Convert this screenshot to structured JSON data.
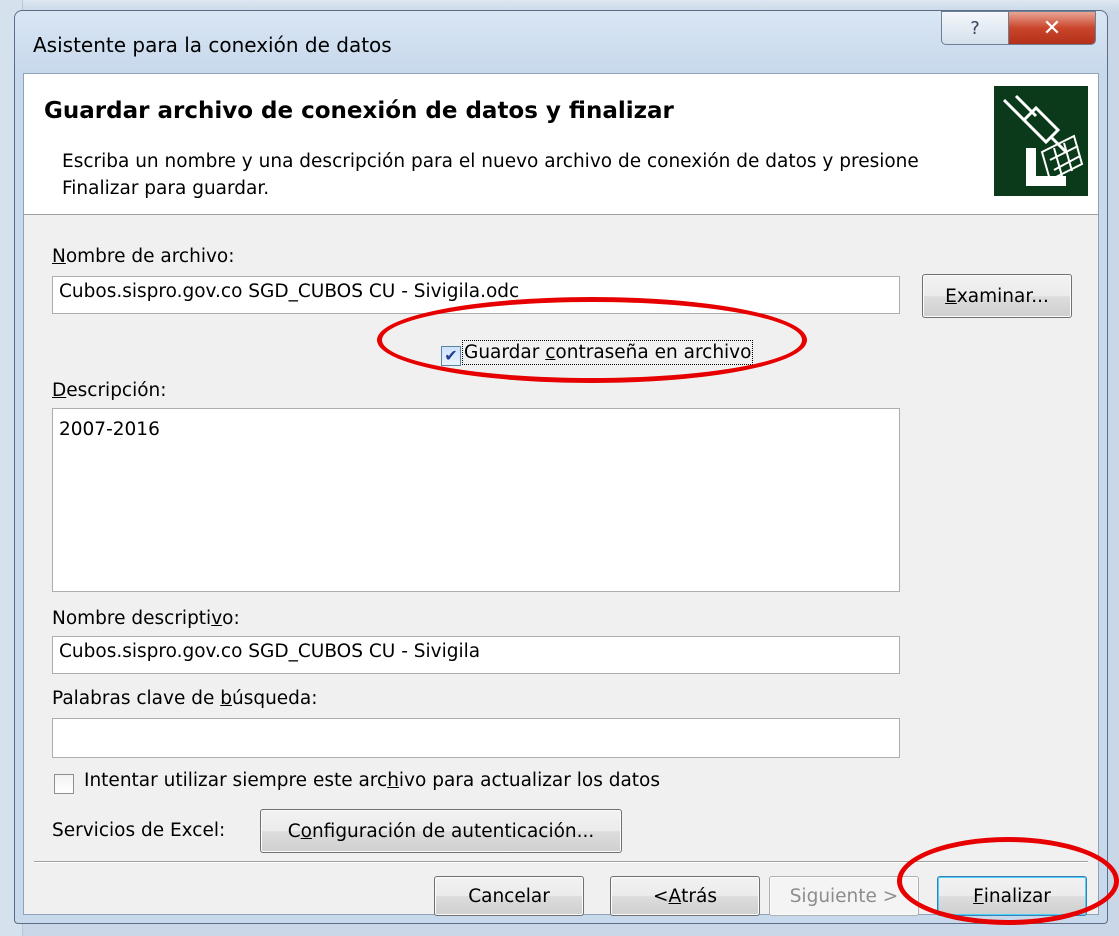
{
  "window": {
    "title": "Asistente para la conexión de datos",
    "help_glyph": "?",
    "close_glyph": "✕"
  },
  "header": {
    "title": "Guardar archivo de conexión de datos y finalizar",
    "description": "Escriba un nombre y una descripción para el nuevo archivo de conexión de datos y presione Finalizar para guardar.",
    "icon": "data-connection-icon"
  },
  "file_name": {
    "label_pre": "",
    "label_access": "N",
    "label_post": "ombre de archivo:",
    "value": "Cubos.sispro.gov.co SGD_CUBOS CU - Sivigila.odc",
    "browse_access": "E",
    "browse_rest": "xaminar..."
  },
  "save_password": {
    "label_pre": "Guardar ",
    "label_access": "c",
    "label_post": "ontraseña en archivo",
    "checked": "✔"
  },
  "description": {
    "label_access": "D",
    "label_post": "escripción:",
    "value": "2007-2016"
  },
  "friendly_name": {
    "label_pre": "Nombre descripti",
    "label_access": "v",
    "label_post": "o:",
    "value": "Cubos.sispro.gov.co SGD_CUBOS CU - Sivigila"
  },
  "keywords": {
    "label_pre": "Palabras clave de ",
    "label_access": "b",
    "label_post": "úsqueda:",
    "value": ""
  },
  "always_use": {
    "label_pre": "Intentar utilizar siempre este arc",
    "label_access": "h",
    "label_post": "ivo para actualizar los datos",
    "checked": ""
  },
  "excel_services": {
    "label": "Servicios de Excel:",
    "button_pre": "C",
    "button_access": "o",
    "button_post": "nfiguración de autenticación..."
  },
  "footer": {
    "cancel": "Cancelar",
    "back_pre": "< ",
    "back_access": "A",
    "back_post": "trás",
    "next": "Siguiente >",
    "finish_access": "F",
    "finish_post": "inalizar"
  },
  "colors": {
    "annotation": "#e60000",
    "icon_bg": "#0b3a1a"
  }
}
